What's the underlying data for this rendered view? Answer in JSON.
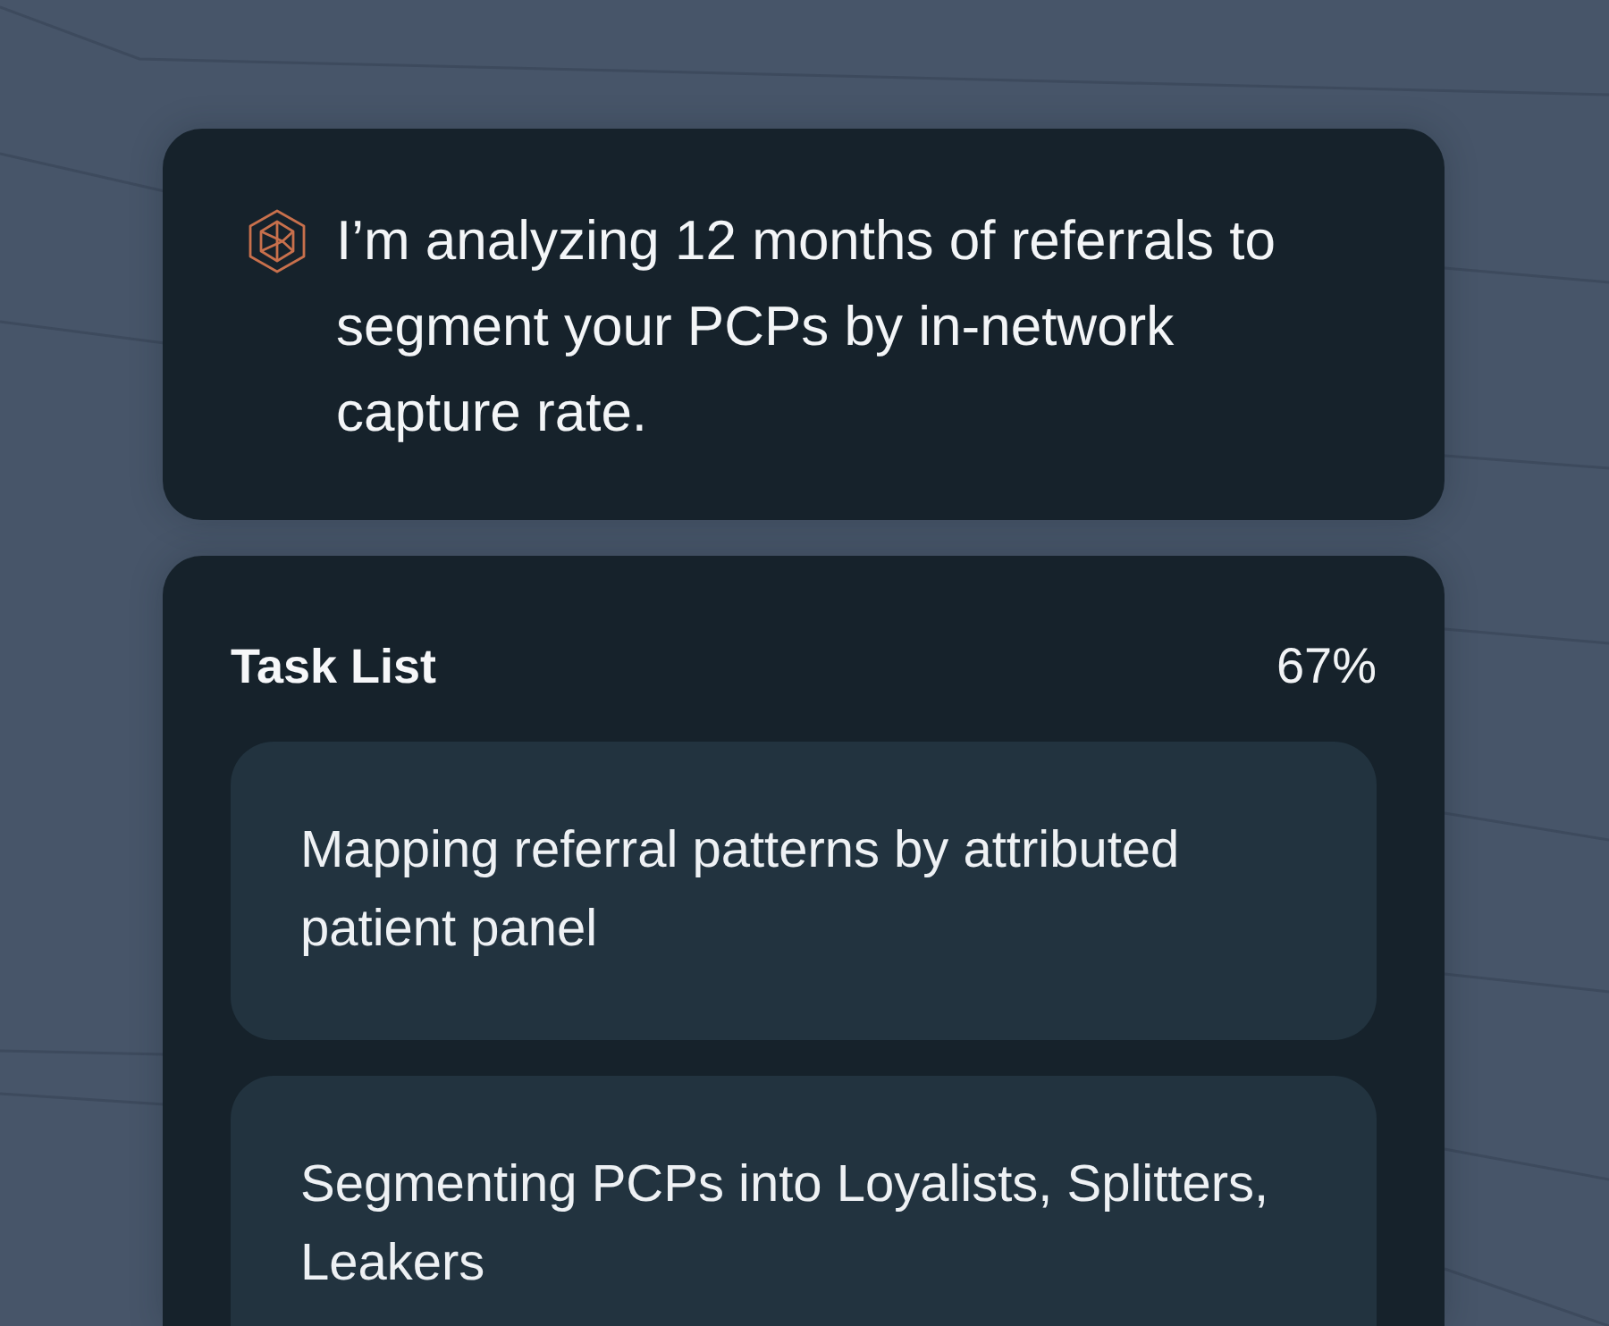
{
  "message": {
    "text": "I’m analyzing 12 months of referrals to segment your PCPs by in-network capture rate."
  },
  "task_list": {
    "title": "Task List",
    "progress": "67%",
    "tasks": [
      {
        "text": "Mapping referral patterns by attributed patient panel"
      },
      {
        "text": "Segmenting PCPs into Loyalists, Splitters, Leakers"
      }
    ]
  }
}
